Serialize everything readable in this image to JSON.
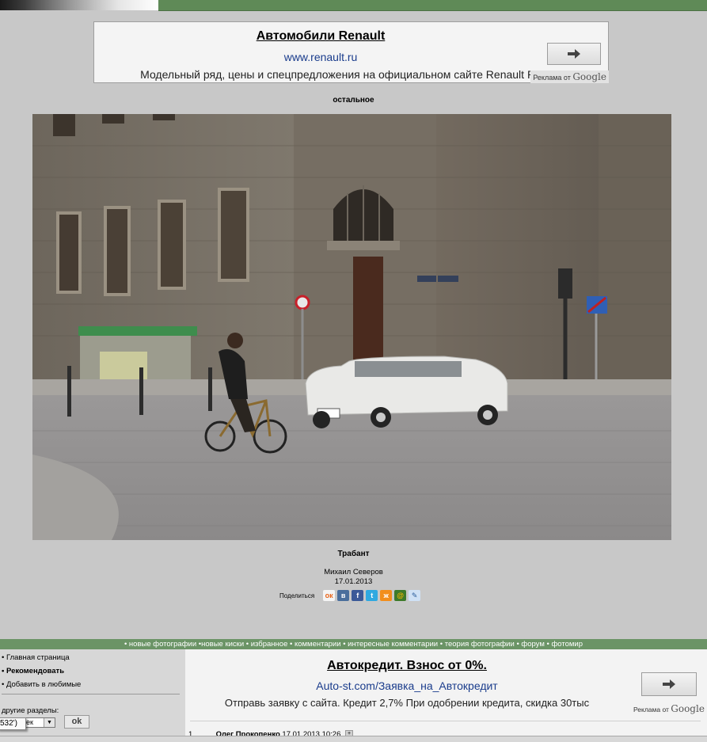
{
  "top_ad": {
    "title": "Автомобили Renault",
    "url": "www.renault.ru",
    "description": "Модельный ряд, цены и спецпредложения на официальном сайте Renault Россия",
    "attribution_prefix": "Реклама от",
    "attribution_brand": "Google"
  },
  "section_label": "остальное",
  "photo": {
    "title": "Трабант",
    "author": "Михаил Северов",
    "date": "17.01.2013"
  },
  "share": {
    "label": "Поделиться",
    "icons": [
      "odnoklassniki-icon",
      "vkontakte-icon",
      "facebook-icon",
      "twitter-icon",
      "moikrug-icon",
      "mailru-icon",
      "livejournal-icon"
    ]
  },
  "nav": {
    "items": [
      "• новые фотографии",
      "•новые киски",
      "• избранное",
      "• комментарии",
      "• интересные комментарии",
      "• теория фотографии",
      "• форум",
      "• фотомир"
    ]
  },
  "sidebar": {
    "home": "• Главная страница",
    "recommend": "• Рекомендовать",
    "favorites": "• Добавить в любимые",
    "other_label": "другие разделы:",
    "select_value": "ек",
    "ok_label": "ok",
    "tooltip": "532')"
  },
  "bottom_ad": {
    "title": "Автокредит. Взнос от 0%.",
    "url": "Auto-st.com/Заявка_на_Автокредит",
    "description": "Отправь заявку с сайта. Кредит 2,7% При одобрении кредита, скидка 30тыс",
    "attribution_prefix": "Реклама от",
    "attribution_brand": "Google"
  },
  "comments": [
    {
      "num": "1.",
      "author": "Олег Прокопенко",
      "date": "17.01.2013 10:26"
    }
  ],
  "colors": {
    "page_bg": "#c8c8c8",
    "nav_green": "#6b9466",
    "link_blue": "#1a3c8c"
  }
}
